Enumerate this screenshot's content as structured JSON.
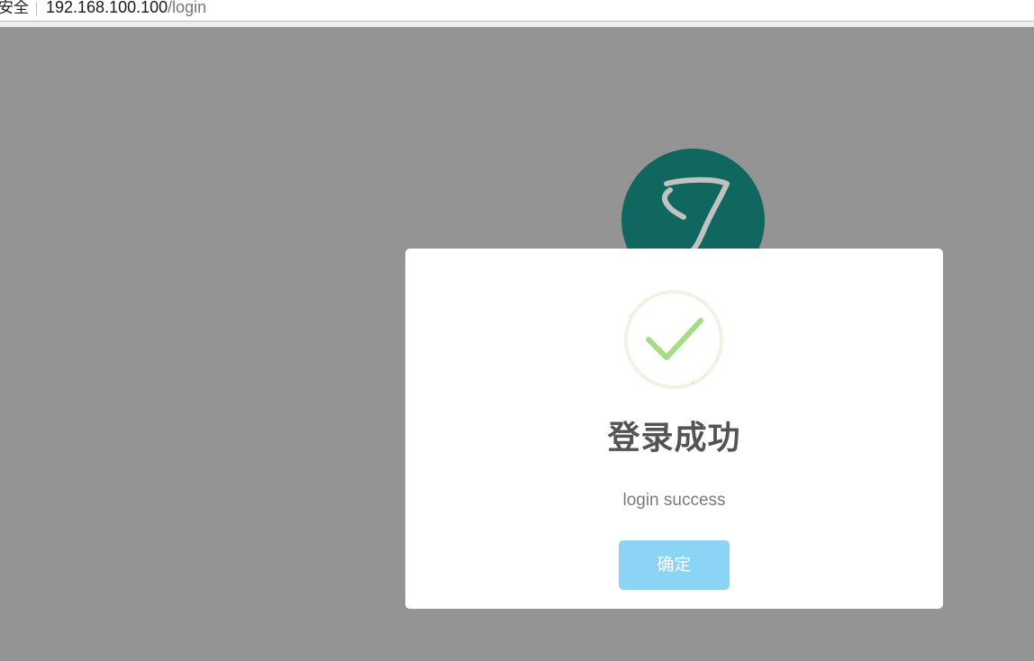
{
  "browser": {
    "security_label": "安全",
    "url_host": "192.168.100.100",
    "url_path": "/login"
  },
  "logo": {
    "icon": "j-logo-icon",
    "background_color": "#0f675f",
    "glyph_color": "#c2c2c2"
  },
  "dialog": {
    "icon": "success-check-icon",
    "title": "登录成功",
    "message": "login success",
    "confirm_label": "确定",
    "confirm_color": "#8cd4f5",
    "check_color": "#a5dc86"
  }
}
